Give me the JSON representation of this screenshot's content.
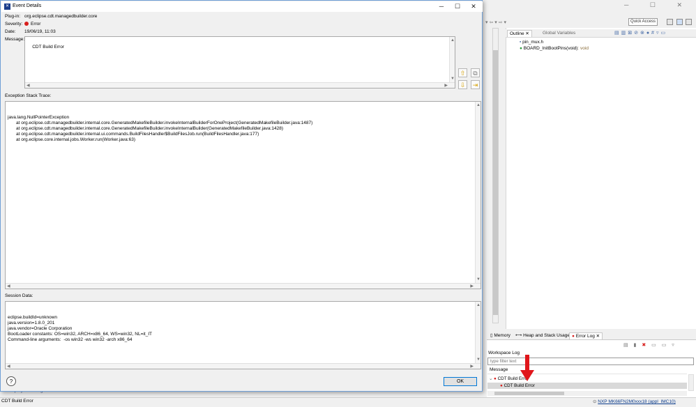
{
  "dialog": {
    "title": "Event Details",
    "plugin_label": "Plug-in:",
    "plugin_value": "org.eclipse.cdt.managedbuilder.core",
    "severity_label": "Severity:",
    "severity_value": "Error",
    "date_label": "Date:",
    "date_value": "19/06/19, 11:03",
    "message_label": "Message:",
    "message_value": "CDT Build Error",
    "stack_label": "Exception Stack Trace:",
    "stack_lines": [
      "java.lang.NullPointerException",
      "\tat org.eclipse.cdt.managedbuilder.internal.core.GeneratedMakefileBuilder.invokeInternalBuilderForOneProject(GeneratedMakefileBuilder.java:1487)",
      "\tat org.eclipse.cdt.managedbuilder.internal.core.GeneratedMakefileBuilder.invokeInternalBuilder(GeneratedMakefileBuilder.java:1428)",
      "\tat org.eclipse.cdt.managedbuilder.internal.ui.commands.BuildFilesHandler$BuildFilesJob.run(BuildFilesHandler.java:177)",
      "\tat org.eclipse.core.internal.jobs.Worker.run(Worker.java:63)"
    ],
    "session_label": "Session Data:",
    "session_lines": [
      "eclipse.buildId=unknown",
      "java.version=1.8.0_201",
      "java.vendor=Oracle Corporation",
      "BootLoader constants: OS=win32, ARCH=x86_64, WS=win32, NL=it_IT",
      "Command-line arguments:  -os win32 -ws win32 -arch x86_64"
    ],
    "ok_label": "OK",
    "help_symbol": "?",
    "min_symbol": "─",
    "max_symbol": "☐",
    "close_symbol": "✕"
  },
  "background": {
    "quick_access": "Quick Access",
    "outline_tab": "Outline",
    "globals_tab": "Global Variables",
    "outline_items": [
      "pin_mux.h",
      "BOARD_InitBootPins(void)"
    ],
    "outline_item_type": ": void",
    "bottom_tabs": [
      "Memory",
      "Heap and Stack Usage",
      "Error Log"
    ],
    "workspace_log": "Workspace Log",
    "filter_placeholder": "type filter text",
    "message_header": "Message",
    "log_rows": [
      "CDT Build Error",
      "CDT Build Error"
    ],
    "edit_project_settings": "Edit project settings",
    "status_left": "CDT Build Error",
    "status_right": "NXP MK66FN2M0xxx18 (appl_IMC10)"
  },
  "colors": {
    "error": "#d8201e",
    "annotation_arrow": "#e0161b",
    "link": "#1a3c84"
  }
}
